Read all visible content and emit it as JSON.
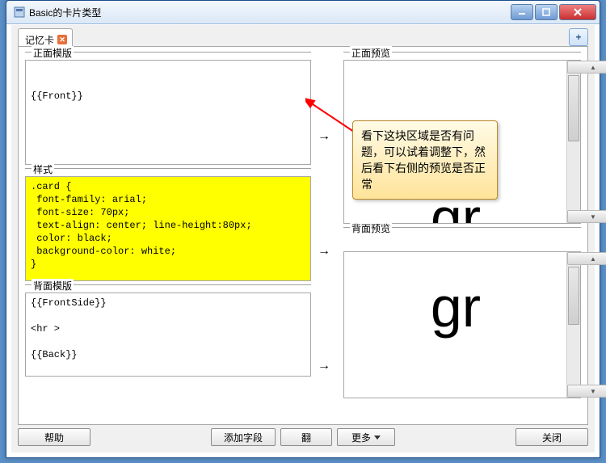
{
  "window": {
    "title": "Basic的卡片类型"
  },
  "tab": {
    "label": "记忆卡"
  },
  "addButton": {
    "label": "+"
  },
  "sections": {
    "frontTemplate": "正面模版",
    "style": "样式",
    "backTemplate": "背面模版",
    "frontPreview": "正面预览",
    "backPreview": "背面预览"
  },
  "editors": {
    "front": "\n\n{{Front}}",
    "style": ".card {\n font-family: arial;\n font-size: 70px;\n text-align: center; line-height:80px;\n color: black;\n background-color: white;\n}",
    "back": "{{FrontSide}}\n\n<hr >\n\n{{Back}}"
  },
  "preview": {
    "frontText": "gr",
    "backText": "gr"
  },
  "arrows": {
    "glyph": "→"
  },
  "callout": {
    "text": "看下这块区域是否有问题，可以试着调整下，然后看下右侧的预览是否正常"
  },
  "footer": {
    "help": "帮助",
    "addField": "添加字段",
    "flip": "翻",
    "more": "更多",
    "close": "关闭"
  }
}
